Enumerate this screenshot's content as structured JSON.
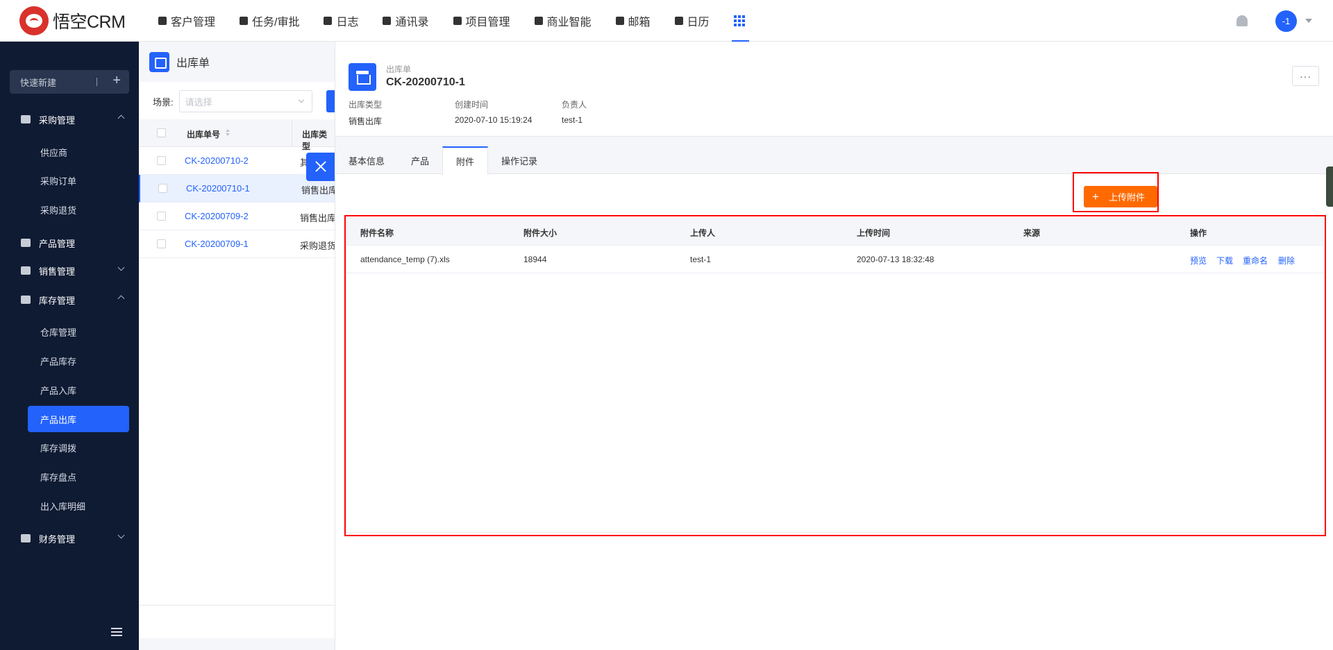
{
  "app": {
    "logo_text": "悟空CRM"
  },
  "nav": {
    "items": [
      {
        "label": "客户管理",
        "icon": "building-icon"
      },
      {
        "label": "任务/审批",
        "icon": "briefcase-icon"
      },
      {
        "label": "日志",
        "icon": "journal-icon"
      },
      {
        "label": "通讯录",
        "icon": "contacts-icon"
      },
      {
        "label": "项目管理",
        "icon": "project-icon"
      },
      {
        "label": "商业智能",
        "icon": "bi-icon"
      },
      {
        "label": "邮箱",
        "icon": "mail-icon"
      },
      {
        "label": "日历",
        "icon": "calendar-icon"
      }
    ],
    "apps_icon": "grid-icon",
    "avatar_text": "-1",
    "accent": "#2362fb"
  },
  "sidebar": {
    "quick_new": "快速新建",
    "groups": {
      "purchase": "采购管理",
      "product": "产品管理",
      "sales": "销售管理",
      "stock": "库存管理",
      "finance": "财务管理"
    },
    "purchase_items": [
      "供应商",
      "采购订单",
      "采购退货"
    ],
    "stock_items": [
      "仓库管理",
      "产品库存",
      "产品入库",
      "产品出库",
      "库存调拨",
      "库存盘点",
      "出入库明细"
    ],
    "active_item": "产品出库",
    "bg": "#0f1b33"
  },
  "list": {
    "title": "出库单",
    "scene_label": "场景:",
    "scene_placeholder": "请选择",
    "col_no": "出库单号",
    "col_type": "出库类型",
    "rows": [
      {
        "no": "CK-20200710-2",
        "type": "其他出库"
      },
      {
        "no": "CK-20200710-1",
        "type": "销售出库"
      },
      {
        "no": "CK-20200709-2",
        "type": "销售出库"
      },
      {
        "no": "CK-20200709-1",
        "type": "采购退货出库"
      }
    ]
  },
  "detail": {
    "sub_title": "出库单",
    "title": "CK-20200710-1",
    "more": "···",
    "meta": [
      {
        "key": "出库类型",
        "value": "销售出库"
      },
      {
        "key": "创建时间",
        "value": "2020-07-10 15:19:24"
      },
      {
        "key": "负责人",
        "value": "test-1"
      }
    ],
    "tabs": [
      "基本信息",
      "产品",
      "附件",
      "操作记录"
    ],
    "active_tab": "附件",
    "upload_button": "上传附件",
    "upload_color": "#ff6a00",
    "attachments": {
      "headers": [
        "附件名称",
        "附件大小",
        "上传人",
        "上传时间",
        "来源",
        "操作"
      ],
      "rows": [
        {
          "name": "attendance_temp (7).xls",
          "size": "18944",
          "uploader": "test-1",
          "time": "2020-07-13 18:32:48",
          "source": "",
          "actions": [
            "预览",
            "下载",
            "重命名",
            "删除"
          ]
        }
      ]
    }
  }
}
